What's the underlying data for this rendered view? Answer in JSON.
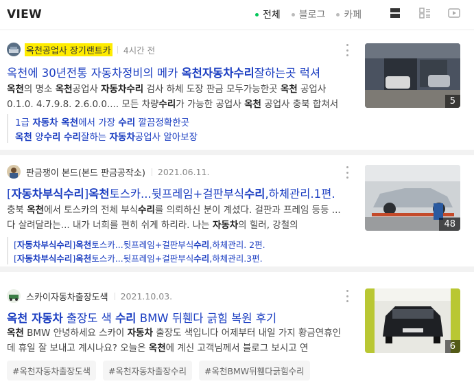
{
  "header": {
    "title": "VIEW",
    "filters": [
      {
        "label": "전체",
        "active": true
      },
      {
        "label": "블로그",
        "active": false
      },
      {
        "label": "카페",
        "active": false
      }
    ],
    "view_icons": [
      "list-view-icon",
      "grid-view-icon",
      "video-view-icon"
    ]
  },
  "results": [
    {
      "author": "옥천공업사 장기랜트카",
      "time": "4시간 전",
      "title_parts": [
        [
          "옥천에 30년전통 자동차정비의 메카 ",
          false
        ],
        [
          "옥천자동차수리",
          true
        ],
        [
          "잘하는곳 럭셔",
          false
        ]
      ],
      "desc_parts": [
        [
          "옥천",
          true
        ],
        [
          "의 명소 ",
          false
        ],
        [
          "옥천",
          true
        ],
        [
          "공업사 ",
          false
        ],
        [
          "자동차수리",
          true
        ],
        [
          " 검사 하체 도장 판금 모두가능한곳 ",
          false
        ],
        [
          "옥천",
          true
        ],
        [
          " 공업사 0.1.0. 4.7.9.8. 2.6.0.0.... 모든 차량",
          false
        ],
        [
          "수리",
          true
        ],
        [
          "가 가능한 공업사 ",
          false
        ],
        [
          "옥천",
          true
        ],
        [
          " 공업사 충북 합쳐서",
          false
        ]
      ],
      "sub_links": [
        [
          [
            "1급 ",
            false
          ],
          [
            "자동차 옥천",
            true
          ],
          [
            "에서 가장 ",
            false
          ],
          [
            "수리",
            true
          ],
          [
            " 깔끔정확한곳",
            false
          ]
        ],
        [
          [
            "옥천",
            true
          ],
          [
            " 양",
            false
          ],
          [
            "수리 수리",
            true
          ],
          [
            "잘하는 ",
            false
          ],
          [
            "자동차",
            true
          ],
          [
            "공업사 알아보장",
            false
          ]
        ]
      ],
      "image_count": "5"
    },
    {
      "author": "판금쟁이 본드(본드 판금공작소)",
      "time": "2021.06.11.",
      "title_parts": [
        [
          "[",
          false
        ],
        [
          "자동차부식수리",
          true
        ],
        [
          "]",
          false
        ],
        [
          "옥천",
          true
        ],
        [
          "토스카...뒷프레임+걸판부식",
          false
        ],
        [
          "수리",
          true
        ],
        [
          ",하체관리.1편.",
          false
        ]
      ],
      "desc_parts": [
        [
          "충북 ",
          false
        ],
        [
          "옥천",
          true
        ],
        [
          "에서 토스카의 전체 부식",
          false
        ],
        [
          "수리",
          true
        ],
        [
          "를 의뢰하신 분이 계셨다. 걸판과 프레임 등등 ... 다 살려달라는... 내가 너희를 편히 쉬게 하리라. 나는 ",
          false
        ],
        [
          "자동차",
          true
        ],
        [
          "의 힐러, 강철의",
          false
        ]
      ],
      "sub_links": [
        [
          [
            "[",
            false
          ],
          [
            "자동차부식수리",
            true
          ],
          [
            "]",
            false
          ],
          [
            "옥천",
            true
          ],
          [
            "토스카...뒷프레임+걸판부식",
            false
          ],
          [
            "수리",
            true
          ],
          [
            ",하체관리. 2편.",
            false
          ]
        ],
        [
          [
            "[",
            false
          ],
          [
            "자동차부식수리",
            true
          ],
          [
            "]",
            false
          ],
          [
            "옥천",
            true
          ],
          [
            "토스카...뒷프레임+걸판부식",
            false
          ],
          [
            "수리",
            true
          ],
          [
            ",하체관리.3편.",
            false
          ]
        ]
      ],
      "image_count": "48"
    },
    {
      "author": "스카이자동차출장도색",
      "time": "2021.10.03.",
      "title_parts": [
        [
          "옥천 자동차",
          true
        ],
        [
          " 출장도 색 ",
          false
        ],
        [
          "수리",
          true
        ],
        [
          " BMW 뒤휀다 긁힘 복원 후기",
          false
        ]
      ],
      "desc_parts": [
        [
          "옥천",
          true
        ],
        [
          " BMW 안녕하세요 스카이 ",
          false
        ],
        [
          "자동차",
          true
        ],
        [
          " 출장도 색입니다 어제부터 내일 가지 황금연휴인데 휴일 잘 보내고 계시나요? 오늘은 ",
          false
        ],
        [
          "옥천",
          true
        ],
        [
          "에 계신 고객님께서 블로그 보시고 연",
          false
        ]
      ],
      "tags": [
        "#옥천자동차출장도색",
        "#옥천자동차출장수리",
        "#옥천BMW뒤휀다긁힘수리"
      ],
      "image_count": "6"
    }
  ],
  "colors": {
    "link": "#1a3dc1",
    "accent": "#03c75a",
    "highlight": "#ffec00"
  }
}
